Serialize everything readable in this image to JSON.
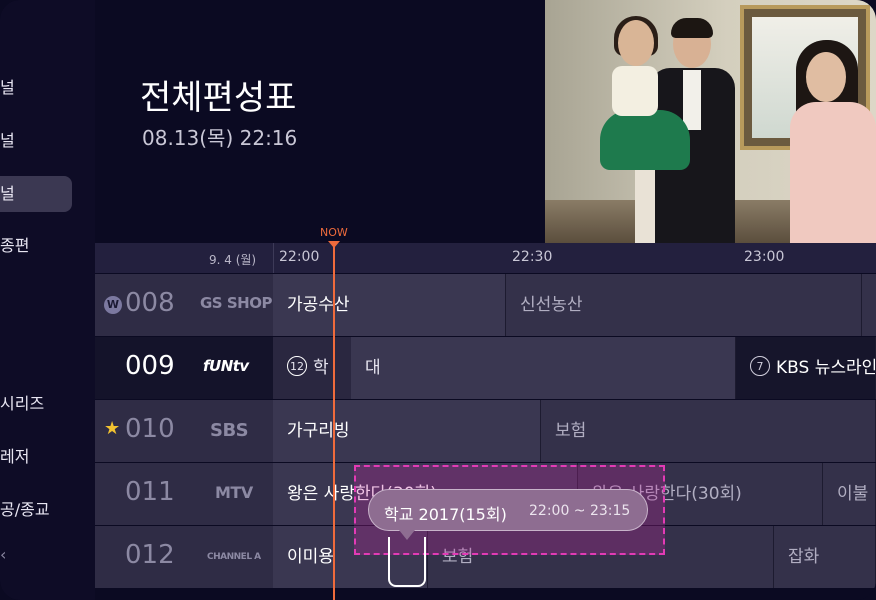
{
  "sidebar": {
    "items": [
      {
        "label": "널"
      },
      {
        "label": "널"
      },
      {
        "label": "널"
      },
      {
        "label": "종편"
      },
      {
        "label": "시리즈"
      },
      {
        "label": "레저"
      },
      {
        "label": "공/종교"
      }
    ],
    "active_index": 2,
    "chevron": "‹"
  },
  "header": {
    "title": "전체편성표",
    "datetime": "08.13(목) 22:16"
  },
  "timebar": {
    "date": "9. 4 (월)",
    "ticks": [
      "22:00",
      "22:30",
      "23:00"
    ],
    "now_label": "NOW"
  },
  "channels": [
    {
      "number": "008",
      "logo": "GS SHOP",
      "badge": "W",
      "programs": [
        {
          "title": "가공수산"
        },
        {
          "title": "신선농산"
        }
      ]
    },
    {
      "number": "009",
      "logo": "fUNtv",
      "programs": [
        {
          "age": "12",
          "title": "학"
        },
        {
          "title": "대"
        },
        {
          "age": "7",
          "title": "KBS 뉴스라인"
        }
      ]
    },
    {
      "number": "010",
      "logo": "SBS",
      "favorite": true,
      "programs": [
        {
          "title": "가구리빙"
        },
        {
          "title": "보험"
        }
      ]
    },
    {
      "number": "011",
      "logo": "MTV",
      "programs": [
        {
          "title": "왕은 사랑한다(30회)"
        },
        {
          "title": "왕은 사랑한다(30회)"
        },
        {
          "title": "이불"
        }
      ]
    },
    {
      "number": "012",
      "logo": "CHANNEL A",
      "programs": [
        {
          "title": "이미용"
        },
        {
          "title": "보험"
        },
        {
          "title": "잡화"
        }
      ]
    }
  ],
  "tooltip": {
    "title": "학교 2017(15회)",
    "time": "22:00 ~ 23:15"
  },
  "colors": {
    "now": "#ef6b3c",
    "highlight": "#e23bb5",
    "background": "#0b0a22"
  }
}
